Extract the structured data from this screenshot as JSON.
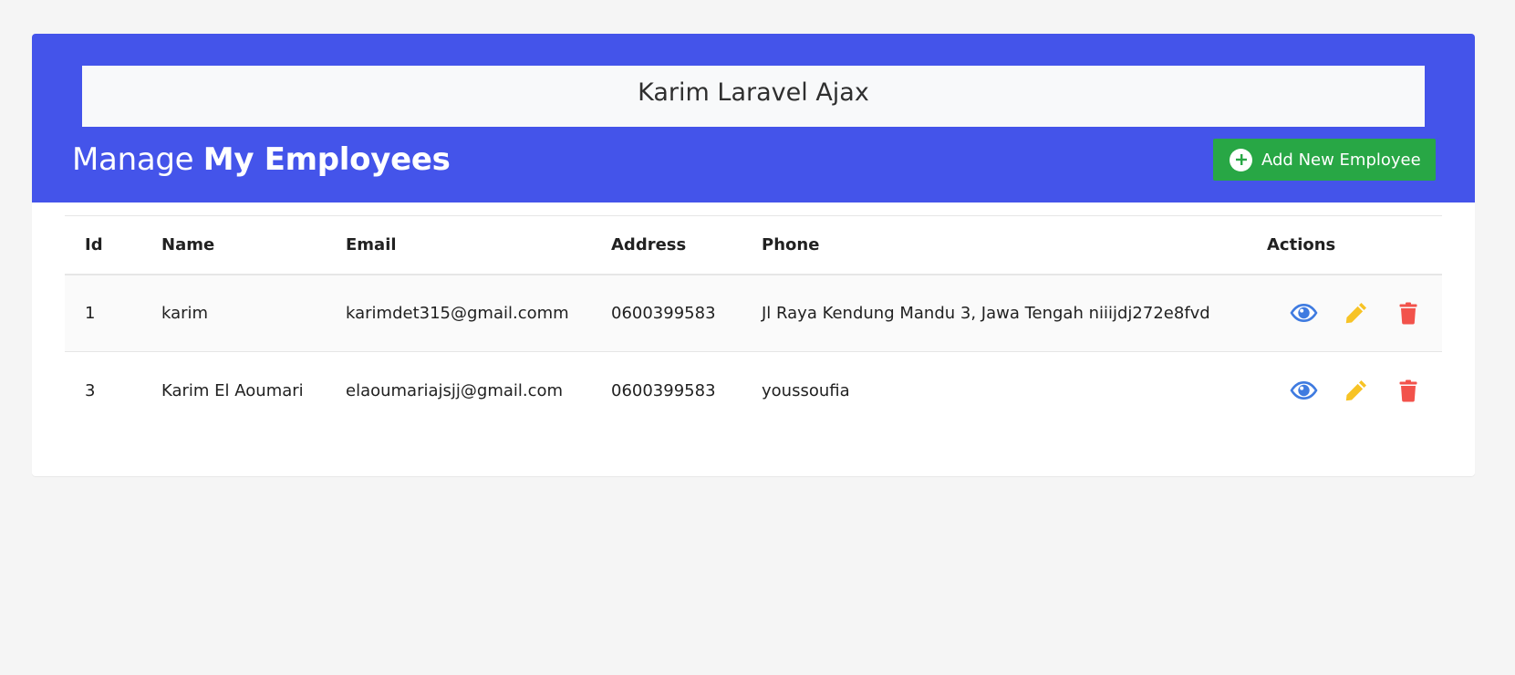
{
  "header": {
    "brand": "Karim Laravel Ajax",
    "title_prefix": "Manage",
    "title_strong": "My Employees",
    "add_button_label": "Add New Employee"
  },
  "colors": {
    "header_bg": "#4454ea",
    "add_button_bg": "#28a745",
    "view_icon": "#3f7be0",
    "edit_icon": "#f7c325",
    "delete_icon": "#f2524b"
  },
  "table": {
    "columns": [
      "Id",
      "Name",
      "Email",
      "Address",
      "Phone",
      "Actions"
    ],
    "rows": [
      {
        "id": "1",
        "name": "karim",
        "email": "karimdet315@gmail.comm",
        "address": "0600399583",
        "phone": "Jl Raya Kendung Mandu 3, Jawa Tengah niiijdj272e8fvd"
      },
      {
        "id": "3",
        "name": "Karim El Aoumari",
        "email": "elaoumariajsjj@gmail.com",
        "address": "0600399583",
        "phone": "youssoufia"
      }
    ],
    "action_icons": [
      "eye-icon",
      "pencil-icon",
      "trash-icon"
    ]
  }
}
